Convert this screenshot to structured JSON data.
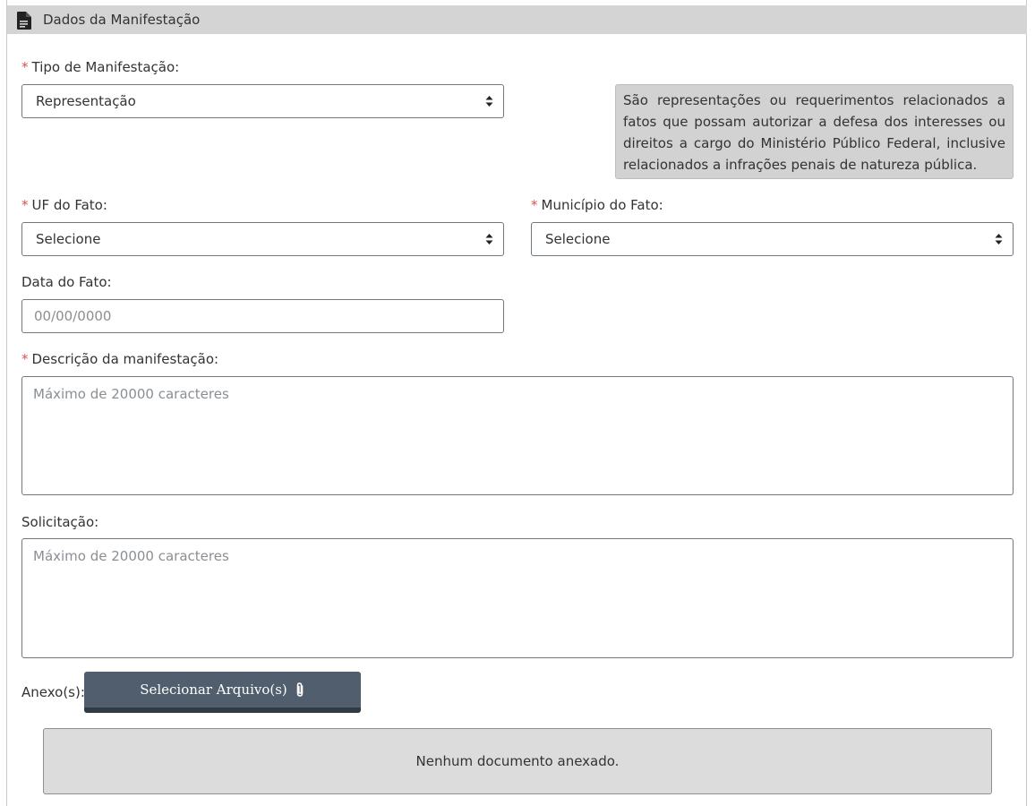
{
  "panel": {
    "title": "Dados da Manifestação",
    "icon": "document-icon"
  },
  "form": {
    "tipo": {
      "required": "*",
      "label": "Tipo de Manifestação:",
      "value": "Representação",
      "info": "São representações ou requerimentos relacionados a fatos que possam autorizar a defesa dos interesses ou direitos a cargo do Ministério Público Federal, inclusive relacionados a infrações penais de natureza pública."
    },
    "uf": {
      "required": "*",
      "label": "UF do Fato:",
      "value": "Selecione"
    },
    "municipio": {
      "required": "*",
      "label": "Município do Fato:",
      "value": "Selecione"
    },
    "data": {
      "label": "Data do Fato:",
      "placeholder": "00/00/0000"
    },
    "descricao": {
      "required": "*",
      "label": "Descrição da manifestação:",
      "placeholder": "Máximo de 20000 caracteres"
    },
    "solicitacao": {
      "label": "Solicitação:",
      "placeholder": "Máximo de 20000 caracteres"
    },
    "anexo": {
      "label": "Anexo(s):",
      "button_label": "Selecionar Arquivo(s)",
      "button_icon": "paperclip-icon",
      "empty_text": "Nenhum documento anexado."
    }
  },
  "colors": {
    "header_bg": "#d4d4d4",
    "required_mark": "#d9534f",
    "button_bg": "#515e6d",
    "info_bg": "#d2d2d2"
  }
}
